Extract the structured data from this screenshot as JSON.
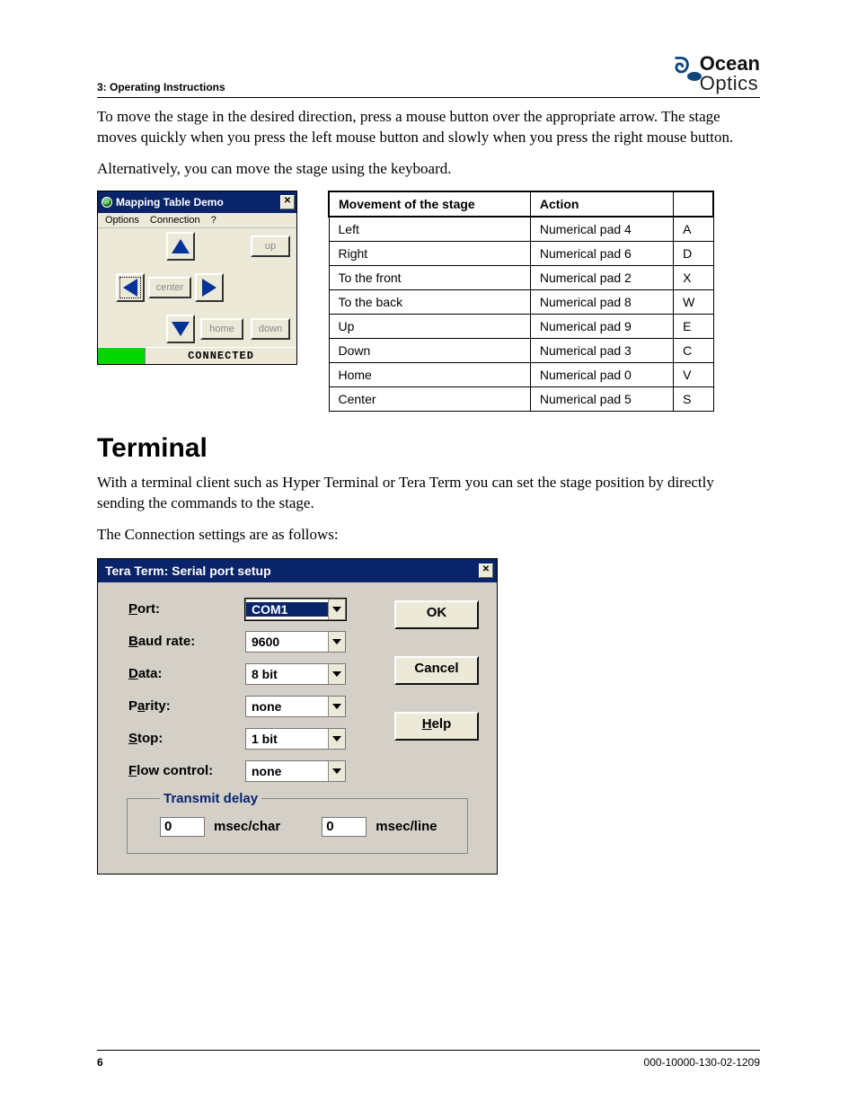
{
  "header": {
    "section_label": "3: Operating Instructions",
    "logo_line1": "Ocean",
    "logo_line2": "Optics"
  },
  "paragraphs": {
    "p1": "To move the stage in the desired direction, press a mouse button over the appropriate arrow. The stage moves quickly when you press the left mouse button and slowly when you press the right mouse button.",
    "p2": "Alternatively, you can move the stage using the keyboard.",
    "terminal_heading": "Terminal",
    "p3": "With a terminal client such as Hyper Terminal or Tera Term you can set the stage position by directly sending the commands to the stage.",
    "p4": "The Connection settings are as follows:"
  },
  "mapping_dialog": {
    "title": "Mapping Table Demo",
    "menu": {
      "options": "Options",
      "connection": "Connection",
      "help": "?"
    },
    "buttons": {
      "up": "up",
      "down": "down",
      "center": "center",
      "home": "home"
    },
    "status": "CONNECTED"
  },
  "movement_table": {
    "headers": {
      "col1": "Movement of the stage",
      "col2": "Action",
      "col3": ""
    },
    "rows": [
      {
        "move": "Left",
        "numpad": "Numerical pad 4",
        "key": "A"
      },
      {
        "move": "Right",
        "numpad": "Numerical pad 6",
        "key": "D"
      },
      {
        "move": "To the front",
        "numpad": "Numerical pad 2",
        "key": "X"
      },
      {
        "move": "To the back",
        "numpad": "Numerical pad 8",
        "key": "W"
      },
      {
        "move": "Up",
        "numpad": "Numerical pad 9",
        "key": "E"
      },
      {
        "move": "Down",
        "numpad": "Numerical pad 3",
        "key": "C"
      },
      {
        "move": "Home",
        "numpad": "Numerical pad 0",
        "key": "V"
      },
      {
        "move": "Center",
        "numpad": "Numerical pad 5",
        "key": "S"
      }
    ]
  },
  "teraterm": {
    "title": "Tera Term: Serial port setup",
    "labels": {
      "port": "Port:",
      "port_ul": "P",
      "baud": "Baud rate:",
      "baud_ul": "B",
      "data": "Data:",
      "data_ul": "D",
      "parity": "Parity:",
      "parity_ul": "a",
      "stop": "Stop:",
      "stop_ul": "S",
      "flow": "Flow control:",
      "flow_ul": "F"
    },
    "values": {
      "port": "COM1",
      "baud": "9600",
      "data": "8 bit",
      "parity": "none",
      "stop": "1 bit",
      "flow": "none"
    },
    "buttons": {
      "ok": "OK",
      "cancel": "Cancel",
      "help": "Help",
      "help_ul": "H"
    },
    "transmit": {
      "legend": "Transmit delay",
      "char_val": "0",
      "char_label": "msec/char",
      "char_ul": "c",
      "line_val": "0",
      "line_label": "msec/line",
      "line_ul": "l"
    }
  },
  "footer": {
    "page": "6",
    "docnum": "000-10000-130-02-1209"
  }
}
